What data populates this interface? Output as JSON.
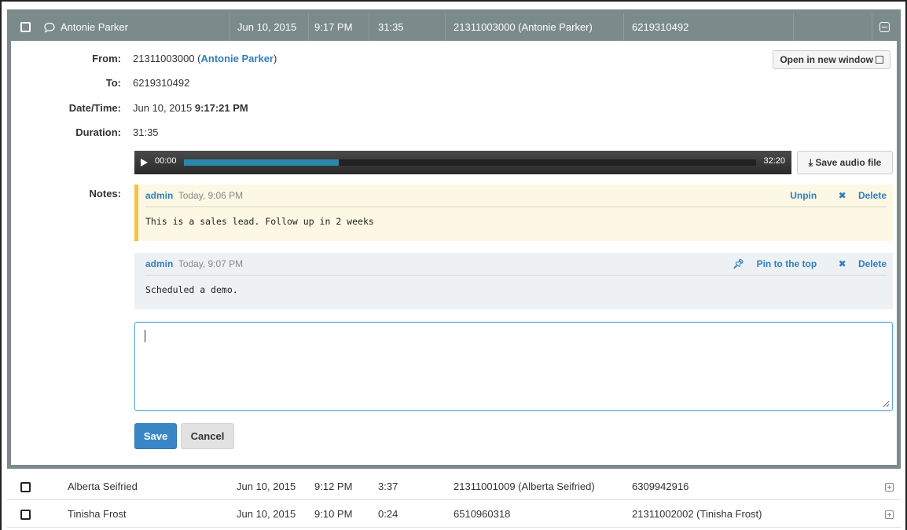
{
  "expanded_call": {
    "contact": "Antonie Parker",
    "date": "Jun 10, 2015",
    "time": "9:17 PM",
    "duration": "31:35",
    "from": "21311003000 (Antonie Parker)",
    "to": "6219310492",
    "details": {
      "from_label": "From:",
      "from_number": "21311003000 (",
      "from_name": "Antonie Parker",
      "from_close": ")",
      "to_label": "To:",
      "to_value": "6219310492",
      "datetime_label": "Date/Time:",
      "datetime_date": "Jun 10, 2015",
      "datetime_time": "9:17:21 PM",
      "duration_label": "Duration:",
      "duration_value": "31:35",
      "notes_label": "Notes:"
    },
    "open_new_window_label": "Open in new window",
    "player": {
      "current_time": "00:00",
      "total_time": "32:20",
      "progress": 0.27
    },
    "save_audio_label": "Save audio file",
    "notes": [
      {
        "author": "admin",
        "time": "Today, 9:06 PM",
        "text": "This is a sales lead. Follow up in 2 weeks",
        "pin_action": "Unpin",
        "delete_action": "Delete",
        "pinned": true
      },
      {
        "author": "admin",
        "time": "Today, 9:07 PM",
        "text": "Scheduled a demo.",
        "pin_action": "Pin to the top",
        "delete_action": "Delete",
        "pinned": false
      }
    ],
    "new_note_value": "",
    "save_label": "Save",
    "cancel_label": "Cancel"
  },
  "rows": [
    {
      "contact": "Alberta Seifried",
      "date": "Jun 10, 2015",
      "time": "9:12 PM",
      "duration": "3:37",
      "from": "21311001009 (Alberta Seifried)",
      "to": "6309942916"
    },
    {
      "contact": "Tinisha Frost",
      "date": "Jun 10, 2015",
      "time": "9:10 PM",
      "duration": "0:24",
      "from": "6510960318",
      "to": "21311002002 (Tinisha Frost)"
    }
  ],
  "colors": {
    "header_bg": "#7b8a8a",
    "link": "#2f7ec1",
    "pinned_bg": "#fcf8e3",
    "pinned_border": "#f5c343",
    "primary_button": "#3a87c8"
  }
}
